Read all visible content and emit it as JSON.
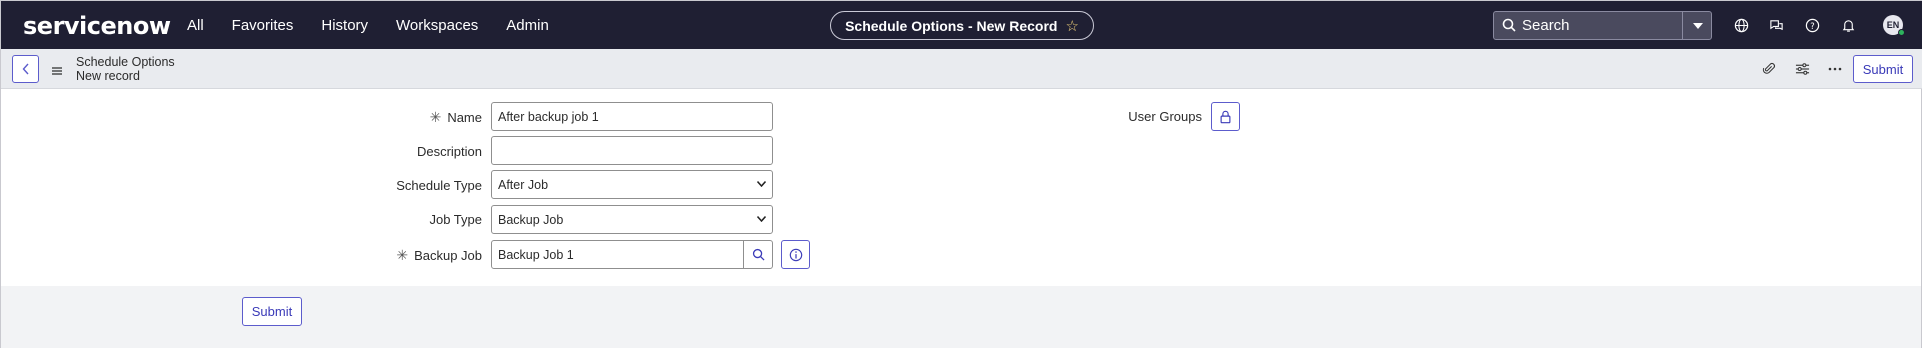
{
  "brand": {
    "logo_text": "servicenow"
  },
  "nav": {
    "items": [
      "All",
      "Favorites",
      "History",
      "Workspaces",
      "Admin"
    ]
  },
  "record_title": "Schedule Options - New Record",
  "search": {
    "label": "Search"
  },
  "user": {
    "initials": "EN"
  },
  "header": {
    "title": "Schedule Options",
    "subtitle": "New record",
    "submit_label": "Submit"
  },
  "form": {
    "name": {
      "label": "Name",
      "value": "After backup job 1",
      "required": true
    },
    "description": {
      "label": "Description",
      "value": ""
    },
    "schedule_type": {
      "label": "Schedule Type",
      "value": "After Job"
    },
    "job_type": {
      "label": "Job Type",
      "value": "Backup Job"
    },
    "backup_job": {
      "label": "Backup Job",
      "value": "Backup Job 1",
      "required": true
    },
    "user_groups": {
      "label": "User Groups"
    }
  },
  "footer": {
    "submit_label": "Submit"
  },
  "colors": {
    "nav_bg": "#1f1f33",
    "accent": "#3a3ab8",
    "header_bg": "#e9ebef"
  }
}
